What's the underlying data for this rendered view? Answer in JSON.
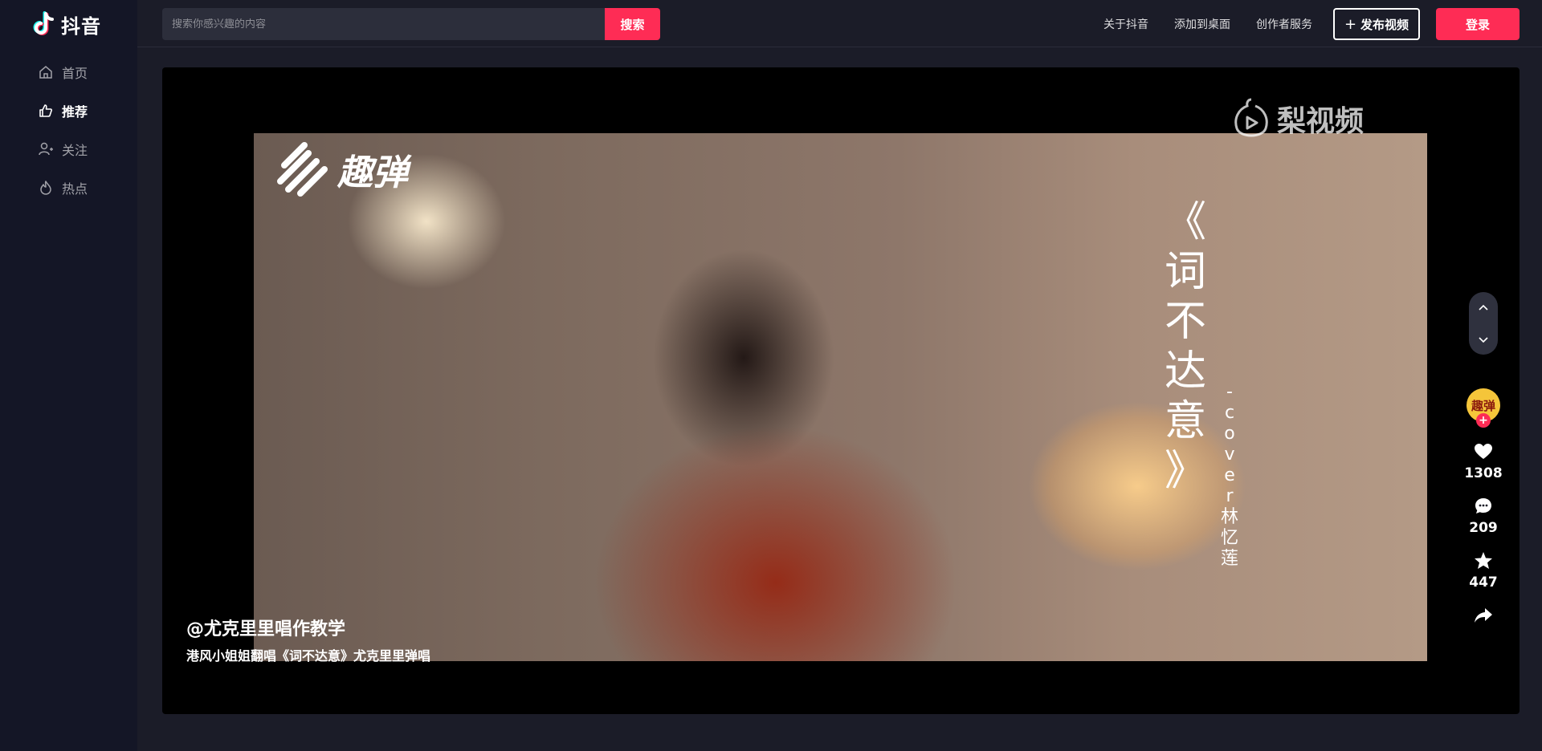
{
  "brand": {
    "name": "抖音"
  },
  "nav": {
    "items": [
      {
        "label": "首页",
        "icon": "home-icon",
        "active": false
      },
      {
        "label": "推荐",
        "icon": "thumbs-up-icon",
        "active": true
      },
      {
        "label": "关注",
        "icon": "follow-user-icon",
        "active": false
      },
      {
        "label": "热点",
        "icon": "flame-icon",
        "active": false
      }
    ]
  },
  "search": {
    "placeholder": "搜索你感兴趣的内容",
    "button_label": "搜索"
  },
  "header": {
    "links": [
      "关于抖音",
      "添加到桌面",
      "创作者服务"
    ],
    "publish_label": "发布视频",
    "login_label": "登录"
  },
  "video": {
    "watermark_left": "趣弹",
    "watermark_right": "梨视频",
    "title_chars": [
      "《",
      "词",
      "不",
      "达",
      "意",
      "》"
    ],
    "cover_chars": [
      "-",
      "c",
      "o",
      "v",
      "e",
      "r",
      "林",
      "忆",
      "莲"
    ],
    "author": "@尤克里里唱作教学",
    "description": "港风小姐姐翻唱《词不达意》尤克里里弹唱"
  },
  "actions": {
    "avatar_text": "趣弹",
    "likes": "1308",
    "comments": "209",
    "favorites": "447"
  },
  "colors": {
    "accent": "#fe2c55",
    "sidebar": "#141626",
    "background": "#1b1c28"
  }
}
